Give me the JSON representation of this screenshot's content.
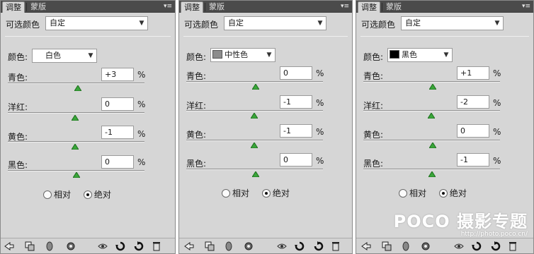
{
  "tabs": {
    "adjustments": "调整",
    "masks": "蒙版"
  },
  "panel_title": "可选颜色",
  "preset_value": "自定",
  "colors_label": "颜色:",
  "percent_sign": "%",
  "row_labels": {
    "cyan": "青色:",
    "magenta": "洋红:",
    "yellow": "黄色:",
    "black": "黑色:"
  },
  "method": {
    "relative": "相对",
    "absolute": "绝对",
    "selected": "absolute"
  },
  "panels": [
    {
      "color_name": "白色",
      "swatch_color": null,
      "values": {
        "cyan": "+3",
        "magenta": "0",
        "yellow": "-1",
        "black": "0"
      }
    },
    {
      "color_name": "中性色",
      "swatch_color": "#8c8c8c",
      "values": {
        "cyan": "0",
        "magenta": "-1",
        "yellow": "-1",
        "black": "0"
      }
    },
    {
      "color_name": "黑色",
      "swatch_color": "#000000",
      "values": {
        "cyan": "+1",
        "magenta": "-2",
        "yellow": "0",
        "black": "-1"
      }
    }
  ],
  "icons": [
    "back-icon",
    "clip-to-layer-icon",
    "visibility-eye-icon",
    "view-previous-state-icon",
    "reset-icon",
    "delete-icon"
  ],
  "watermark": {
    "brand": "POCO 摄影专题",
    "url": "http://photo.poco.cn/"
  }
}
